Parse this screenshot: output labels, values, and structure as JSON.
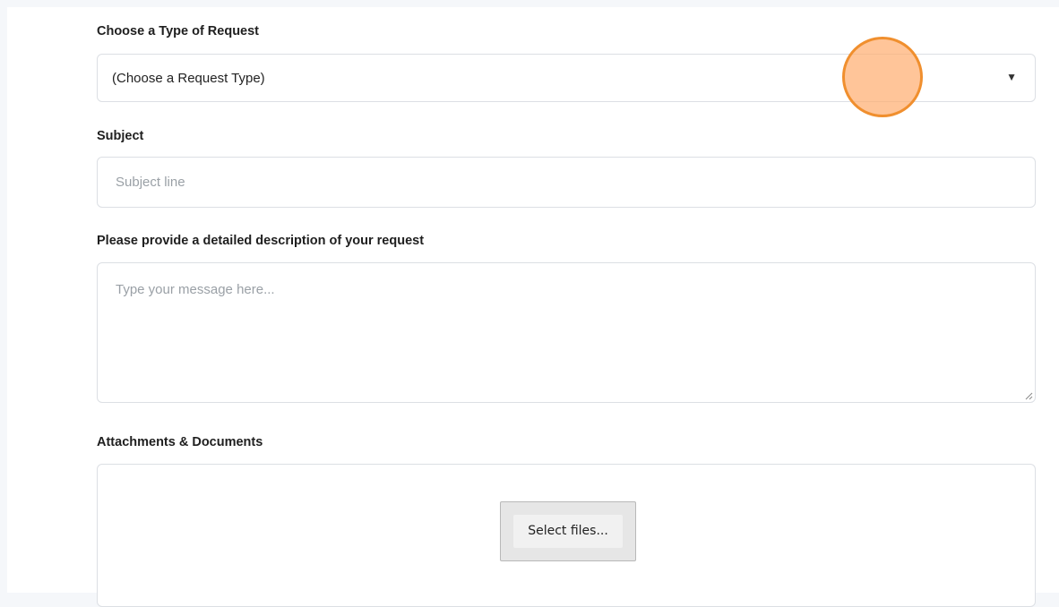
{
  "form": {
    "request_type": {
      "label": "Choose a Type of Request",
      "selected_value": "(Choose a Request Type)",
      "arrow_glyph": "▼",
      "icon": "caret-down-icon"
    },
    "subject": {
      "label": "Subject",
      "placeholder": "Subject line"
    },
    "description": {
      "label": "Please provide a detailed description of your request",
      "placeholder": "Type your message here..."
    },
    "attachments": {
      "label": "Attachments & Documents",
      "button_label": "Select files..."
    }
  },
  "colors": {
    "background": "#f5f7fa",
    "field_border": "#dcdfe4",
    "placeholder": "#9aa0a6",
    "cursor_highlight": "#f08f2e"
  }
}
